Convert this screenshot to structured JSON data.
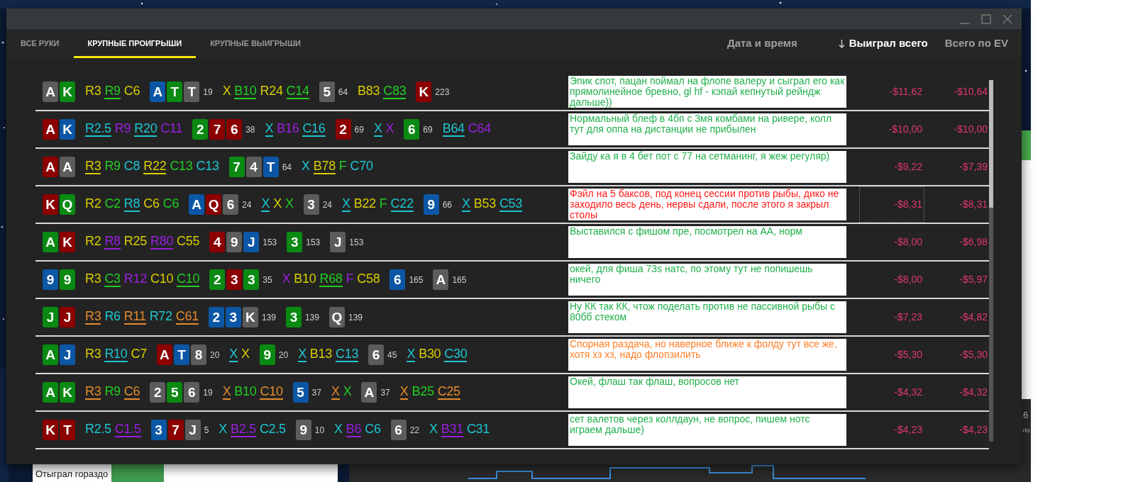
{
  "background_app": {
    "label": "Отыграл гораздо",
    "fragments": [
      "6",
      "ло"
    ]
  },
  "tabs": [
    {
      "label": "ВСЕ РУКИ",
      "selected": false
    },
    {
      "label": "КРУПНЫЕ ПРОИГРЫШИ",
      "selected": true
    },
    {
      "label": "КРУПНЫЕ ВЫИГРЫШИ",
      "selected": false
    }
  ],
  "columns": [
    {
      "label": "Дата и время",
      "sorted": false
    },
    {
      "label": "Выиграл всего",
      "sorted": true
    },
    {
      "label": "Всего по EV",
      "sorted": false
    }
  ],
  "rows": [
    {
      "focused": false,
      "note": {
        "text": "Эпик спот, пацан поймал на флопе валеру и сыграл его как прямолинейное бревно, gl hf - кэпай кепнутый рейндж дальше))",
        "color": "#22b04c"
      },
      "won": "-$11,62",
      "ev": "-$10,64",
      "tokens": [
        {
          "kind": "card",
          "text": "A",
          "color": "#5c5c5c"
        },
        {
          "kind": "card",
          "text": "K",
          "color": "#0a8a12"
        },
        {
          "kind": "action",
          "text": "R3",
          "color": "#d8cc00",
          "underlined": false
        },
        {
          "kind": "action",
          "text": "R9",
          "color": "#22cc22",
          "underlined": true
        },
        {
          "kind": "action",
          "text": "C6",
          "color": "#d8cc00",
          "underlined": false
        },
        {
          "kind": "card",
          "text": "A",
          "color": "#0b57a6"
        },
        {
          "kind": "card",
          "text": "T",
          "color": "#0a8a12"
        },
        {
          "kind": "card",
          "text": "T",
          "color": "#5c5c5c"
        },
        {
          "kind": "pot",
          "text": "19"
        },
        {
          "kind": "action",
          "text": "X",
          "color": "#d8cc00",
          "underlined": false
        },
        {
          "kind": "action",
          "text": "B10",
          "color": "#22cc22",
          "underlined": true
        },
        {
          "kind": "action",
          "text": "R24",
          "color": "#d8cc00",
          "underlined": false
        },
        {
          "kind": "action",
          "text": "C14",
          "color": "#22cc22",
          "underlined": true
        },
        {
          "kind": "card",
          "text": "5",
          "color": "#5c5c5c"
        },
        {
          "kind": "pot",
          "text": "64"
        },
        {
          "kind": "action",
          "text": "B83",
          "color": "#d8cc00",
          "underlined": false
        },
        {
          "kind": "action",
          "text": "C83",
          "color": "#22cc22",
          "underlined": true
        },
        {
          "kind": "card",
          "text": "K",
          "color": "#8c0000"
        },
        {
          "kind": "pot",
          "text": "223"
        }
      ]
    },
    {
      "focused": false,
      "note": {
        "text": "Нормальный блеф в 4бп с 3мя комбами на ривере, колл тут для оппа на дистанции не прибылен",
        "color": "#22b04c"
      },
      "won": "-$10,00",
      "ev": "-$10,00",
      "tokens": [
        {
          "kind": "card",
          "text": "A",
          "color": "#8c0000"
        },
        {
          "kind": "card",
          "text": "K",
          "color": "#0b57a6"
        },
        {
          "kind": "action",
          "text": "R2.5",
          "color": "#1cc6d2",
          "underlined": true
        },
        {
          "kind": "action",
          "text": "R9",
          "color": "#9a1ee0",
          "underlined": false
        },
        {
          "kind": "action",
          "text": "R20",
          "color": "#1cc6d2",
          "underlined": true
        },
        {
          "kind": "action",
          "text": "C11",
          "color": "#9a1ee0",
          "underlined": false
        },
        {
          "kind": "card",
          "text": "2",
          "color": "#0a8a12"
        },
        {
          "kind": "card",
          "text": "7",
          "color": "#8c0000"
        },
        {
          "kind": "card",
          "text": "6",
          "color": "#8c0000"
        },
        {
          "kind": "pot",
          "text": "38"
        },
        {
          "kind": "action",
          "text": "X",
          "color": "#1cc6d2",
          "underlined": true
        },
        {
          "kind": "action",
          "text": "B16",
          "color": "#9a1ee0",
          "underlined": false
        },
        {
          "kind": "action",
          "text": "C16",
          "color": "#1cc6d2",
          "underlined": true
        },
        {
          "kind": "card",
          "text": "2",
          "color": "#8c0000"
        },
        {
          "kind": "pot",
          "text": "69"
        },
        {
          "kind": "action",
          "text": "X",
          "color": "#1cc6d2",
          "underlined": true
        },
        {
          "kind": "action",
          "text": "X",
          "color": "#9a1ee0",
          "underlined": false
        },
        {
          "kind": "card",
          "text": "6",
          "color": "#0a8a12"
        },
        {
          "kind": "pot",
          "text": "69"
        },
        {
          "kind": "action",
          "text": "B64",
          "color": "#1cc6d2",
          "underlined": true
        },
        {
          "kind": "action",
          "text": "C64",
          "color": "#9a1ee0",
          "underlined": false
        }
      ]
    },
    {
      "focused": false,
      "note": {
        "text": "Зайду ка я в 4 бет пот с 77 на сетманинг, я жеж регуляр)",
        "color": "#22b04c"
      },
      "won": "-$9,22",
      "ev": "-$7,39",
      "tokens": [
        {
          "kind": "card",
          "text": "A",
          "color": "#8c0000"
        },
        {
          "kind": "card",
          "text": "A",
          "color": "#5c5c5c"
        },
        {
          "kind": "action",
          "text": "R3",
          "color": "#d8cc00",
          "underlined": true
        },
        {
          "kind": "action",
          "text": "R9",
          "color": "#22cc22",
          "underlined": false
        },
        {
          "kind": "action",
          "text": "C8",
          "color": "#1cc6d2",
          "underlined": false
        },
        {
          "kind": "action",
          "text": "R22",
          "color": "#d8cc00",
          "underlined": true
        },
        {
          "kind": "action",
          "text": "C13",
          "color": "#22cc22",
          "underlined": false
        },
        {
          "kind": "action",
          "text": "C13",
          "color": "#1cc6d2",
          "underlined": false
        },
        {
          "kind": "card",
          "text": "7",
          "color": "#0a8a12"
        },
        {
          "kind": "card",
          "text": "4",
          "color": "#5c5c5c"
        },
        {
          "kind": "card",
          "text": "T",
          "color": "#0b57a6"
        },
        {
          "kind": "pot",
          "text": "64"
        },
        {
          "kind": "action",
          "text": "X",
          "color": "#1cc6d2",
          "underlined": false
        },
        {
          "kind": "action",
          "text": "B78",
          "color": "#d8cc00",
          "underlined": true
        },
        {
          "kind": "action",
          "text": "F",
          "color": "#22cc22",
          "underlined": false
        },
        {
          "kind": "action",
          "text": "C70",
          "color": "#1cc6d2",
          "underlined": false
        }
      ]
    },
    {
      "focused": true,
      "note": {
        "text": "Фэйл на 5 баксов, под конец сессии против рыбы, дико не заходило весь день, нервы сдали, после этого я закрыл столы",
        "color": "#ff1a1a"
      },
      "won": "-$8,31",
      "ev": "-$8,31",
      "tokens": [
        {
          "kind": "card",
          "text": "K",
          "color": "#8c0000"
        },
        {
          "kind": "card",
          "text": "Q",
          "color": "#0a8a12"
        },
        {
          "kind": "action",
          "text": "R2",
          "color": "#d8cc00",
          "underlined": false
        },
        {
          "kind": "action",
          "text": "C2",
          "color": "#22cc22",
          "underlined": false
        },
        {
          "kind": "action",
          "text": "R8",
          "color": "#1cc6d2",
          "underlined": true
        },
        {
          "kind": "action",
          "text": "C6",
          "color": "#d8cc00",
          "underlined": false
        },
        {
          "kind": "action",
          "text": "C6",
          "color": "#22cc22",
          "underlined": false
        },
        {
          "kind": "card",
          "text": "A",
          "color": "#0b57a6"
        },
        {
          "kind": "card",
          "text": "Q",
          "color": "#8c0000"
        },
        {
          "kind": "card",
          "text": "6",
          "color": "#5c5c5c"
        },
        {
          "kind": "pot",
          "text": "24"
        },
        {
          "kind": "action",
          "text": "X",
          "color": "#1cc6d2",
          "underlined": true
        },
        {
          "kind": "action",
          "text": "X",
          "color": "#d8cc00",
          "underlined": false
        },
        {
          "kind": "action",
          "text": "X",
          "color": "#22cc22",
          "underlined": false
        },
        {
          "kind": "card",
          "text": "3",
          "color": "#5c5c5c"
        },
        {
          "kind": "pot",
          "text": "24"
        },
        {
          "kind": "action",
          "text": "X",
          "color": "#1cc6d2",
          "underlined": true
        },
        {
          "kind": "action",
          "text": "B22",
          "color": "#d8cc00",
          "underlined": false
        },
        {
          "kind": "action",
          "text": "F",
          "color": "#22cc22",
          "underlined": false
        },
        {
          "kind": "action",
          "text": "C22",
          "color": "#1cc6d2",
          "underlined": true
        },
        {
          "kind": "card",
          "text": "9",
          "color": "#0b57a6"
        },
        {
          "kind": "pot",
          "text": "66"
        },
        {
          "kind": "action",
          "text": "X",
          "color": "#1cc6d2",
          "underlined": true
        },
        {
          "kind": "action",
          "text": "B53",
          "color": "#d8cc00",
          "underlined": false
        },
        {
          "kind": "action",
          "text": "C53",
          "color": "#1cc6d2",
          "underlined": true
        }
      ]
    },
    {
      "focused": false,
      "note": {
        "text": "Выставился с фишом пре, посмотрел на АА, норм",
        "color": "#22b04c"
      },
      "won": "-$8,00",
      "ev": "-$6,98",
      "tokens": [
        {
          "kind": "card",
          "text": "A",
          "color": "#0a8a12"
        },
        {
          "kind": "card",
          "text": "K",
          "color": "#8c0000"
        },
        {
          "kind": "action",
          "text": "R2",
          "color": "#d8cc00",
          "underlined": false
        },
        {
          "kind": "action",
          "text": "R8",
          "color": "#9a1ee0",
          "underlined": true
        },
        {
          "kind": "action",
          "text": "R25",
          "color": "#d8cc00",
          "underlined": false
        },
        {
          "kind": "action",
          "text": "R80",
          "color": "#9a1ee0",
          "underlined": true
        },
        {
          "kind": "action",
          "text": "C55",
          "color": "#d8cc00",
          "underlined": false
        },
        {
          "kind": "card",
          "text": "4",
          "color": "#8c0000"
        },
        {
          "kind": "card",
          "text": "9",
          "color": "#5c5c5c"
        },
        {
          "kind": "card",
          "text": "J",
          "color": "#0b57a6"
        },
        {
          "kind": "pot",
          "text": "153"
        },
        {
          "kind": "card",
          "text": "3",
          "color": "#0a8a12"
        },
        {
          "kind": "pot",
          "text": "153"
        },
        {
          "kind": "card",
          "text": "J",
          "color": "#5c5c5c"
        },
        {
          "kind": "pot",
          "text": "153"
        }
      ]
    },
    {
      "focused": false,
      "note": {
        "text": "окей, для фиша 73s натс, по этому тут не попишешь ничего",
        "color": "#22b04c"
      },
      "won": "-$8,00",
      "ev": "-$5,97",
      "tokens": [
        {
          "kind": "card",
          "text": "9",
          "color": "#0b57a6"
        },
        {
          "kind": "card",
          "text": "9",
          "color": "#0a8a12"
        },
        {
          "kind": "action",
          "text": "R3",
          "color": "#d8cc00",
          "underlined": false
        },
        {
          "kind": "action",
          "text": "C3",
          "color": "#22cc22",
          "underlined": true
        },
        {
          "kind": "action",
          "text": "R12",
          "color": "#9a1ee0",
          "underlined": false
        },
        {
          "kind": "action",
          "text": "C10",
          "color": "#d8cc00",
          "underlined": false
        },
        {
          "kind": "action",
          "text": "C10",
          "color": "#22cc22",
          "underlined": true
        },
        {
          "kind": "card",
          "text": "2",
          "color": "#0a8a12"
        },
        {
          "kind": "card",
          "text": "3",
          "color": "#8c0000"
        },
        {
          "kind": "card",
          "text": "3",
          "color": "#0a8a12"
        },
        {
          "kind": "pot",
          "text": "35"
        },
        {
          "kind": "action",
          "text": "X",
          "color": "#9a1ee0",
          "underlined": false
        },
        {
          "kind": "action",
          "text": "B10",
          "color": "#d8cc00",
          "underlined": false
        },
        {
          "kind": "action",
          "text": "R68",
          "color": "#22cc22",
          "underlined": true
        },
        {
          "kind": "action",
          "text": "F",
          "color": "#9a1ee0",
          "underlined": false
        },
        {
          "kind": "action",
          "text": "C58",
          "color": "#d8cc00",
          "underlined": false
        },
        {
          "kind": "card",
          "text": "6",
          "color": "#0b57a6"
        },
        {
          "kind": "pot",
          "text": "165"
        },
        {
          "kind": "card",
          "text": "A",
          "color": "#5c5c5c"
        },
        {
          "kind": "pot",
          "text": "165"
        }
      ]
    },
    {
      "focused": false,
      "note": {
        "text": "Ну КК так КК, чтож поделать против не пассивной рыбы с 80бб стеком",
        "color": "#22b04c"
      },
      "won": "-$7,23",
      "ev": "-$4,82",
      "tokens": [
        {
          "kind": "card",
          "text": "J",
          "color": "#0a8a12"
        },
        {
          "kind": "card",
          "text": "J",
          "color": "#8c0000"
        },
        {
          "kind": "action",
          "text": "R3",
          "color": "#e38b2b",
          "underlined": true
        },
        {
          "kind": "action",
          "text": "R6",
          "color": "#1cc6d2",
          "underlined": false
        },
        {
          "kind": "action",
          "text": "R11",
          "color": "#e38b2b",
          "underlined": true
        },
        {
          "kind": "action",
          "text": "R72",
          "color": "#1cc6d2",
          "underlined": false
        },
        {
          "kind": "action",
          "text": "C61",
          "color": "#e38b2b",
          "underlined": true
        },
        {
          "kind": "card",
          "text": "2",
          "color": "#0b57a6"
        },
        {
          "kind": "card",
          "text": "3",
          "color": "#0b57a6"
        },
        {
          "kind": "card",
          "text": "K",
          "color": "#5c5c5c"
        },
        {
          "kind": "pot",
          "text": "139"
        },
        {
          "kind": "card",
          "text": "3",
          "color": "#0a8a12"
        },
        {
          "kind": "pot",
          "text": "139"
        },
        {
          "kind": "card",
          "text": "Q",
          "color": "#5c5c5c"
        },
        {
          "kind": "pot",
          "text": "139"
        }
      ]
    },
    {
      "focused": false,
      "note": {
        "text": "Спорная раздача, но наверное ближе к фолду тут все же, хотя хз хз, надо флопзилить",
        "color": "#ff7f27"
      },
      "won": "-$5,30",
      "ev": "-$5,30",
      "tokens": [
        {
          "kind": "card",
          "text": "A",
          "color": "#0a8a12"
        },
        {
          "kind": "card",
          "text": "J",
          "color": "#0b57a6"
        },
        {
          "kind": "action",
          "text": "R3",
          "color": "#d8cc00",
          "underlined": false
        },
        {
          "kind": "action",
          "text": "R10",
          "color": "#1cc6d2",
          "underlined": true
        },
        {
          "kind": "action",
          "text": "C7",
          "color": "#d8cc00",
          "underlined": false
        },
        {
          "kind": "card",
          "text": "A",
          "color": "#8c0000"
        },
        {
          "kind": "card",
          "text": "T",
          "color": "#0b57a6"
        },
        {
          "kind": "card",
          "text": "8",
          "color": "#5c5c5c"
        },
        {
          "kind": "pot",
          "text": "20"
        },
        {
          "kind": "action",
          "text": "X",
          "color": "#1cc6d2",
          "underlined": true
        },
        {
          "kind": "action",
          "text": "X",
          "color": "#d8cc00",
          "underlined": false
        },
        {
          "kind": "card",
          "text": "9",
          "color": "#0a8a12"
        },
        {
          "kind": "pot",
          "text": "20"
        },
        {
          "kind": "action",
          "text": "X",
          "color": "#1cc6d2",
          "underlined": true
        },
        {
          "kind": "action",
          "text": "B13",
          "color": "#d8cc00",
          "underlined": false
        },
        {
          "kind": "action",
          "text": "C13",
          "color": "#1cc6d2",
          "underlined": true
        },
        {
          "kind": "card",
          "text": "6",
          "color": "#5c5c5c"
        },
        {
          "kind": "pot",
          "text": "45"
        },
        {
          "kind": "action",
          "text": "X",
          "color": "#1cc6d2",
          "underlined": true
        },
        {
          "kind": "action",
          "text": "B30",
          "color": "#d8cc00",
          "underlined": false
        },
        {
          "kind": "action",
          "text": "C30",
          "color": "#1cc6d2",
          "underlined": true
        }
      ]
    },
    {
      "focused": false,
      "note": {
        "text": "Окей, флаш так флаш, вопросов нет",
        "color": "#22b04c"
      },
      "won": "-$4,32",
      "ev": "-$4,32",
      "tokens": [
        {
          "kind": "card",
          "text": "A",
          "color": "#0a8a12"
        },
        {
          "kind": "card",
          "text": "K",
          "color": "#0a8a12"
        },
        {
          "kind": "action",
          "text": "R3",
          "color": "#e38b2b",
          "underlined": true
        },
        {
          "kind": "action",
          "text": "R9",
          "color": "#22cc22",
          "underlined": false
        },
        {
          "kind": "action",
          "text": "C6",
          "color": "#e38b2b",
          "underlined": true
        },
        {
          "kind": "card",
          "text": "2",
          "color": "#5c5c5c"
        },
        {
          "kind": "card",
          "text": "5",
          "color": "#0a8a12"
        },
        {
          "kind": "card",
          "text": "6",
          "color": "#5c5c5c"
        },
        {
          "kind": "pot",
          "text": "19"
        },
        {
          "kind": "action",
          "text": "X",
          "color": "#e38b2b",
          "underlined": true
        },
        {
          "kind": "action",
          "text": "B10",
          "color": "#22cc22",
          "underlined": false
        },
        {
          "kind": "action",
          "text": "C10",
          "color": "#e38b2b",
          "underlined": true
        },
        {
          "kind": "card",
          "text": "5",
          "color": "#0b57a6"
        },
        {
          "kind": "pot",
          "text": "37"
        },
        {
          "kind": "action",
          "text": "X",
          "color": "#e38b2b",
          "underlined": true
        },
        {
          "kind": "action",
          "text": "X",
          "color": "#22cc22",
          "underlined": false
        },
        {
          "kind": "card",
          "text": "A",
          "color": "#5c5c5c"
        },
        {
          "kind": "pot",
          "text": "37"
        },
        {
          "kind": "action",
          "text": "X",
          "color": "#e38b2b",
          "underlined": true
        },
        {
          "kind": "action",
          "text": "B25",
          "color": "#22cc22",
          "underlined": false
        },
        {
          "kind": "action",
          "text": "C25",
          "color": "#e38b2b",
          "underlined": true
        }
      ]
    },
    {
      "focused": false,
      "note": {
        "text": "сет валетов через коллдаун, не вопрос, пишем нотс играем дальше)",
        "color": "#22b04c"
      },
      "won": "-$4,23",
      "ev": "-$4,23",
      "tokens": [
        {
          "kind": "card",
          "text": "K",
          "color": "#8c0000"
        },
        {
          "kind": "card",
          "text": "T",
          "color": "#8c0000"
        },
        {
          "kind": "action",
          "text": "R2.5",
          "color": "#1cc6d2",
          "underlined": false
        },
        {
          "kind": "action",
          "text": "C1.5",
          "color": "#9a1ee0",
          "underlined": true
        },
        {
          "kind": "card",
          "text": "3",
          "color": "#0b57a6"
        },
        {
          "kind": "card",
          "text": "7",
          "color": "#8c0000"
        },
        {
          "kind": "card",
          "text": "J",
          "color": "#5c5c5c"
        },
        {
          "kind": "pot",
          "text": "5"
        },
        {
          "kind": "action",
          "text": "X",
          "color": "#1cc6d2",
          "underlined": false
        },
        {
          "kind": "action",
          "text": "B2.5",
          "color": "#9a1ee0",
          "underlined": true
        },
        {
          "kind": "action",
          "text": "C2.5",
          "color": "#1cc6d2",
          "underlined": false
        },
        {
          "kind": "card",
          "text": "9",
          "color": "#5c5c5c"
        },
        {
          "kind": "pot",
          "text": "10"
        },
        {
          "kind": "action",
          "text": "X",
          "color": "#1cc6d2",
          "underlined": false
        },
        {
          "kind": "action",
          "text": "B6",
          "color": "#9a1ee0",
          "underlined": true
        },
        {
          "kind": "action",
          "text": "C6",
          "color": "#1cc6d2",
          "underlined": false
        },
        {
          "kind": "card",
          "text": "6",
          "color": "#5c5c5c"
        },
        {
          "kind": "pot",
          "text": "22"
        },
        {
          "kind": "action",
          "text": "X",
          "color": "#1cc6d2",
          "underlined": false
        },
        {
          "kind": "action",
          "text": "B31",
          "color": "#9a1ee0",
          "underlined": true
        },
        {
          "kind": "action",
          "text": "C31",
          "color": "#1cc6d2",
          "underlined": false
        }
      ]
    }
  ]
}
